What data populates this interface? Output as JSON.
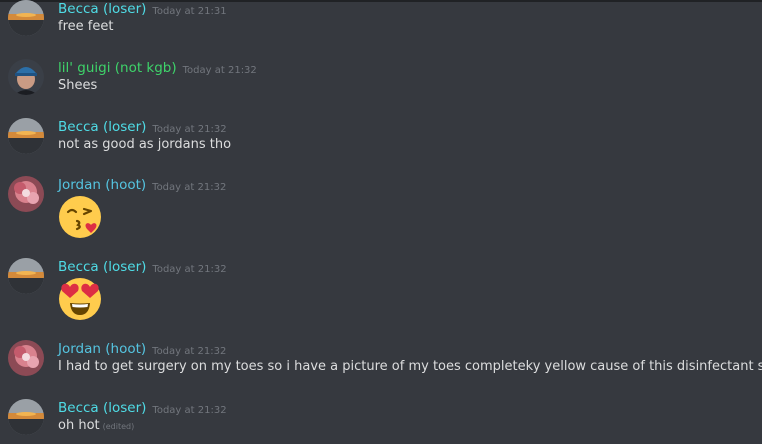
{
  "colors": {
    "background": "#36393f",
    "text": "#dcddde",
    "timestamp": "#72767d",
    "becca_name": "#4fdce6",
    "guigi_name": "#3ed36a",
    "jordan_name": "#55c4e0"
  },
  "messages": [
    {
      "author": "Becca (loser)",
      "timestamp": "Today at 21:31",
      "text": "free feet"
    },
    {
      "author": "lil' guigi (not kgb)",
      "timestamp": "Today at 21:32",
      "text": "Shees"
    },
    {
      "author": "Becca (loser)",
      "timestamp": "Today at 21:32",
      "text": "not as good as jordans tho"
    },
    {
      "author": "Jordan (hoot)",
      "timestamp": "Today at 21:32",
      "emoji": "face-blowing-a-kiss-emoji"
    },
    {
      "author": "Becca (loser)",
      "timestamp": "Today at 21:32",
      "emoji": "heart-eyes-emoji"
    },
    {
      "author": "Jordan (hoot)",
      "timestamp": "Today at 21:32",
      "text": "I had to get surgery on my toes so i have a picture of my toes completeky yellow cause of this disinfectant stuff"
    },
    {
      "author": "Becca (loser)",
      "timestamp": "Today at 21:32",
      "text": "oh hot",
      "edited_label": "(edited)"
    }
  ]
}
